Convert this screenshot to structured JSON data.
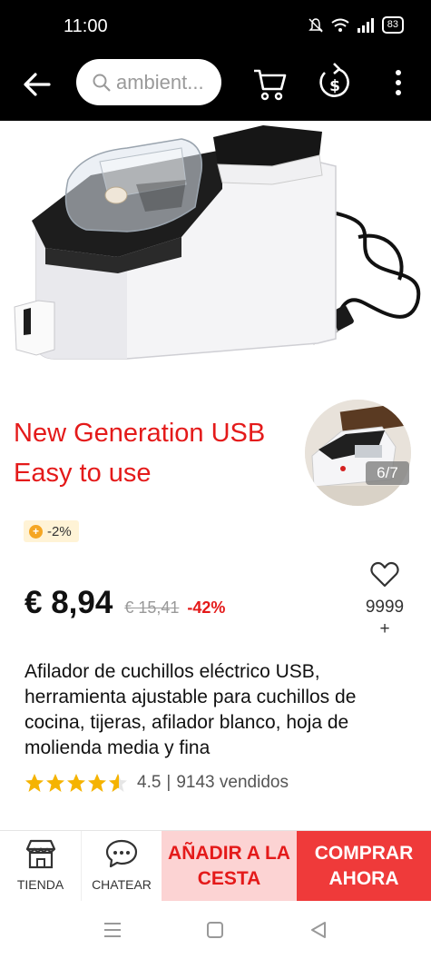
{
  "status": {
    "time": "11:00",
    "battery": "83"
  },
  "search": {
    "placeholder": "ambient..."
  },
  "product": {
    "promo_line1": "New Generation USB",
    "promo_line2": "Easy to use",
    "image_counter": "6/7",
    "coins_discount": "-2%",
    "price": "€ 8,94",
    "original_price": "€ 15,41",
    "discount": "-42%",
    "wishlist_count": "9999\n+",
    "title": "Afilador de cuchillos eléctrico USB, herramienta ajustable para cuchillos de cocina, tijeras, afilador blanco, hoja de molienda media y fina",
    "rating": "4.5",
    "rating_value": 4.5,
    "sold": "9143 vendidos"
  },
  "bottom_bar": {
    "store_label": "TIENDA",
    "chat_label": "CHATEAR",
    "add_to_cart": "AÑADIR A LA CESTA",
    "buy_now": "COMPRAR AHORA"
  },
  "colors": {
    "accent": "#e41a1a",
    "buy_bg": "#ef3a3a",
    "cart_bg": "#fcd3d3",
    "star": "#f5b301"
  }
}
